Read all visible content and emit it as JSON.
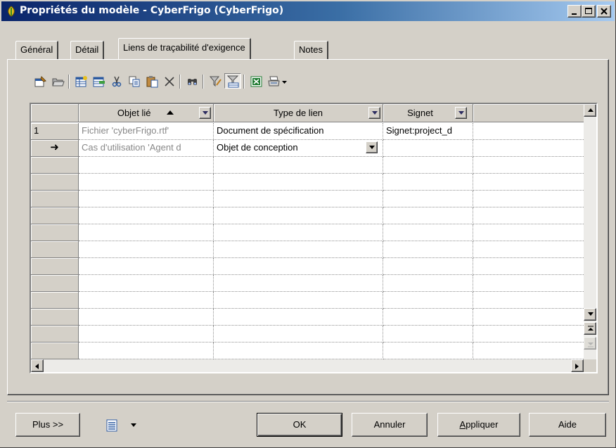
{
  "window": {
    "title": "Propriétés du modèle - CyberFrigo (CyberFrigo)"
  },
  "tabs": [
    {
      "label": "Général",
      "active": false
    },
    {
      "label": "Détail",
      "active": false
    },
    {
      "label": "Liens de traçabilité d'exigence",
      "active": true
    },
    {
      "label": "Notes",
      "active": false
    }
  ],
  "toolbar": {
    "icons": [
      "properties-icon",
      "open-icon",
      "add-rows-icon",
      "insert-row-icon",
      "cut-icon",
      "copy-icon",
      "paste-icon",
      "delete-icon",
      "find-icon",
      "filter-icon",
      "enable-filter-icon",
      "excel-export-icon",
      "print-icon",
      "dropdown-arrow-icon"
    ]
  },
  "grid": {
    "columns": [
      {
        "label": "Objet lié",
        "sort": "ascending"
      },
      {
        "label": "Type de lien"
      },
      {
        "label": "Signet"
      }
    ],
    "rows": [
      {
        "marker": "1",
        "objet": "Fichier 'cyberFrigo.rtf'",
        "type": "Document de spécification",
        "signet": "Signet:project_d"
      },
      {
        "marker": "➜",
        "objet": "Cas d'utilisation 'Agent d",
        "type": "Objet de conception",
        "signet": ""
      }
    ]
  },
  "footer": {
    "more_label": "Plus >>",
    "ok_label": "OK",
    "cancel_label": "Annuler",
    "apply_label": "Appliquer",
    "help_label": "Aide"
  }
}
